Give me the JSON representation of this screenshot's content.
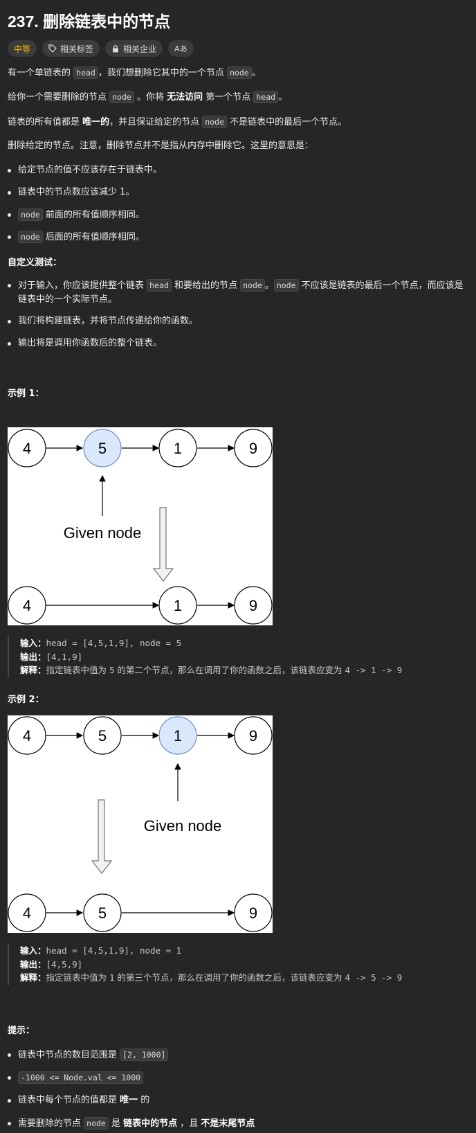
{
  "title": "237. 删除链表中的节点",
  "tags": {
    "difficulty": "中等",
    "related_tags": "相关标签",
    "related_companies": "相关企业",
    "translate": "Aあ"
  },
  "desc": {
    "p1_a": "有一个单链表的 ",
    "p1_code1": "head",
    "p1_b": "，我们想删除它其中的一个节点 ",
    "p1_code2": "node",
    "p1_c": "。",
    "p2_a": "给你一个需要删除的节点 ",
    "p2_code1": "node",
    "p2_b": " 。你将 ",
    "p2_bold": "无法访问",
    "p2_c": " 第一个节点  ",
    "p2_code2": "head",
    "p2_d": "。",
    "p3_a": "链表的所有值都是 ",
    "p3_bold": "唯一的",
    "p3_b": "，并且保证给定的节点 ",
    "p3_code": "node",
    "p3_c": " 不是链表中的最后一个节点。",
    "p4": "删除给定的节点。注意，删除节点并不是指从内存中删除它。这里的意思是："
  },
  "rules": {
    "r1": "给定节点的值不应该存在于链表中。",
    "r2": "链表中的节点数应该减少 1。",
    "r3_code": "node",
    "r3_text": " 前面的所有值顺序相同。",
    "r4_code": "node",
    "r4_text": " 后面的所有值顺序相同。"
  },
  "custom_test": {
    "heading": "自定义测试：",
    "c1_a": "对于输入，你应该提供整个链表 ",
    "c1_code1": "head",
    "c1_b": " 和要给出的节点 ",
    "c1_code2": "node",
    "c1_c": "。",
    "c1_code3": "node",
    "c1_d": " 不应该是链表的最后一个节点，而应该是链表中的一个实际节点。",
    "c2": "我们将构建链表，并将节点传递给你的函数。",
    "c3": "输出将是调用你函数后的整个链表。"
  },
  "example1": {
    "heading": "示例 1：",
    "top_nodes": [
      "4",
      "5",
      "1",
      "9"
    ],
    "bottom_nodes": [
      "4",
      "1",
      "9"
    ],
    "given_label": "Given node",
    "input_label": "输入：",
    "input": "head = [4,5,1,9], node = 5",
    "output_label": "输出：",
    "output": "[4,1,9]",
    "expl_label": "解释：",
    "expl_a": "指定链表中值为 ",
    "expl_val": "5",
    "expl_b": " 的第二个节点，那么在调用了你的函数之后，该链表应变为 ",
    "expl_result": "4 -> 1 -> 9"
  },
  "example2": {
    "heading": "示例 2：",
    "top_nodes": [
      "4",
      "5",
      "1",
      "9"
    ],
    "bottom_nodes": [
      "4",
      "5",
      "9"
    ],
    "given_label": "Given node",
    "input_label": "输入：",
    "input": "head = [4,5,1,9], node = 1",
    "output_label": "输出：",
    "output": "[4,5,9]",
    "expl_label": "解释：",
    "expl_a": "指定链表中值为 ",
    "expl_val": "1",
    "expl_b": " 的第三个节点，那么在调用了你的函数之后，该链表应变为 ",
    "expl_result": "4 -> 5 -> 9"
  },
  "hints": {
    "heading": "提示：",
    "h1_text": "链表中节点的数目范围是 ",
    "h1_code": "[2, 1000]",
    "h2_code": "-1000 <= Node.val <= 1000",
    "h3_a": "链表中每个节点的值都是 ",
    "h3_bold": "唯一",
    "h3_b": " 的",
    "h4_a": "需要删除的节点 ",
    "h4_code": "node",
    "h4_b": " 是 ",
    "h4_bold1": "链表中的节点",
    "h4_c": " ，且 ",
    "h4_bold2": "不是末尾节点"
  },
  "colors": {
    "background": "#262626",
    "difficulty": "#ffb800",
    "highlight_node": "#dae8fc",
    "highlight_stroke": "#6c8ebf"
  }
}
